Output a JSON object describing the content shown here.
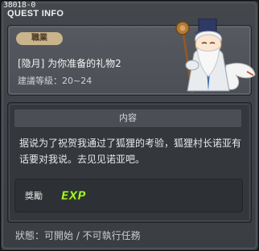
{
  "window": {
    "quest_id": "38018-0",
    "title": "QUEST INFO"
  },
  "quest": {
    "job_badge": "職業",
    "name": "[隐月] 为你准备的礼物2",
    "recommended_level": "建議等級：20~24"
  },
  "content": {
    "section_title": "内容",
    "description": "据说为了祝贺我通过了狐狸的考验，狐狸村长诺亚有话要对我说。去见见诺亚吧。"
  },
  "reward": {
    "label": "獎勵",
    "icon": "exp-icon",
    "icon_text": "EXP",
    "icon_color": "#b8ff3a"
  },
  "status": {
    "text": "狀態：可開始 / 不可執行任務"
  },
  "colors": {
    "badge_bg": "#c9b48c",
    "panel_bg": "#3c3f44"
  }
}
